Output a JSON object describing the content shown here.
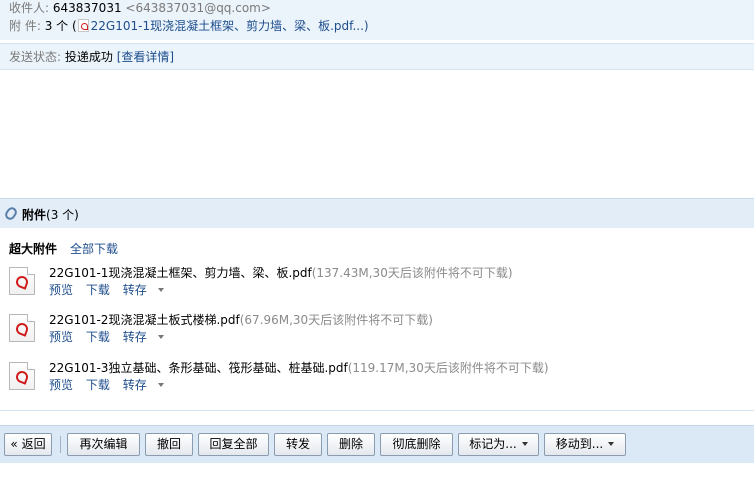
{
  "header": {
    "recipient_label": "收件人:",
    "recipient_name": "643837031",
    "recipient_email": "<643837031@qq.com>",
    "attachment_label": "附 件:",
    "attachment_summary": "3 个 (",
    "attachment_first_link": "22G101-1现浇混凝土框架、剪力墙、梁、板.pdf...)"
  },
  "status": {
    "label": "发送状态:",
    "value": "投递成功",
    "details_link": "[查看详情]"
  },
  "attachments": {
    "title": "附件",
    "count": "(3 个)",
    "section_label": "超大附件",
    "download_all": "全部下载",
    "files": [
      {
        "name": "22G101-1现浇混凝土框架、剪力墙、梁、板.pdf",
        "meta": "(137.43M,30天后该附件将不可下载)",
        "preview": "预览",
        "download": "下载",
        "save_to": "转存"
      },
      {
        "name": "22G101-2现浇混凝土板式楼梯.pdf",
        "meta": "(67.96M,30天后该附件将不可下载)",
        "preview": "预览",
        "download": "下载",
        "save_to": "转存"
      },
      {
        "name": "22G101-3独立基础、条形基础、筏形基础、桩基础.pdf",
        "meta": "(119.17M,30天后该附件将不可下载)",
        "preview": "预览",
        "download": "下载",
        "save_to": "转存"
      }
    ]
  },
  "toolbar": {
    "back": "« 返回",
    "edit_again": "再次编辑",
    "recall": "撤回",
    "reply_all": "回复全部",
    "forward": "转发",
    "delete": "删除",
    "delete_permanently": "彻底删除",
    "mark_as": "标记为...",
    "move_to": "移动到..."
  },
  "colors": {
    "link": "#1e4e8c",
    "header_bg": "#ebf3fb",
    "toolbar_bg": "#dbe8f6",
    "meta_text": "#8a8a8a"
  }
}
